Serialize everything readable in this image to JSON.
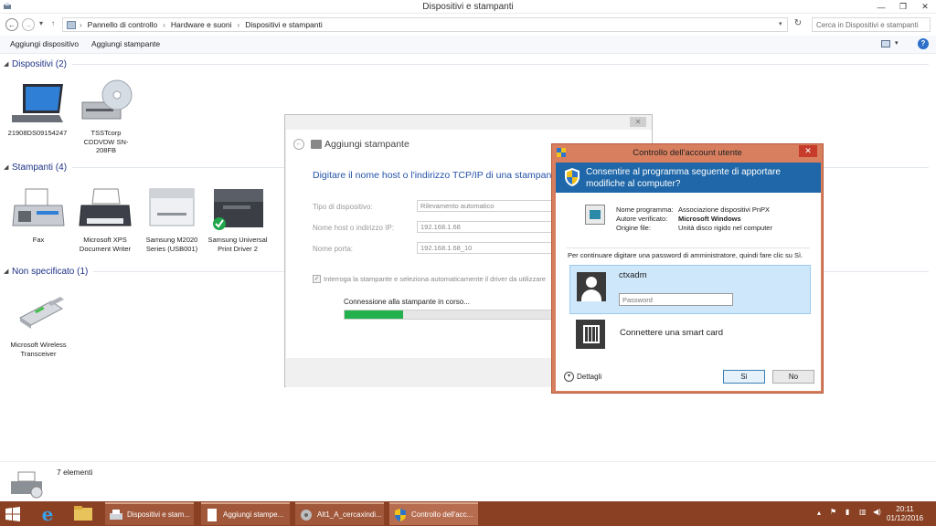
{
  "window": {
    "title": "Dispositivi e stampanti",
    "controls": [
      "—",
      "❐",
      "✕"
    ]
  },
  "address": {
    "crumbs": [
      "Pannello di controllo",
      "Hardware e suoni",
      "Dispositivi e stampanti"
    ],
    "search_placeholder": "Cerca in Dispositivi e stampanti"
  },
  "toolbar": {
    "add_device": "Aggiungi dispositivo",
    "add_printer": "Aggiungi stampante"
  },
  "groups": {
    "devices": "Dispositivi (2)",
    "printers": "Stampanti (4)",
    "unspecified": "Non specificato (1)"
  },
  "devices": [
    {
      "label": "21908DS09154247",
      "icon": "laptop-icon"
    },
    {
      "label": "TSSTcorp CDDVDW SN-208FB",
      "icon": "dvd-drive-icon"
    }
  ],
  "printers": [
    {
      "label": "Fax",
      "icon": "fax-icon"
    },
    {
      "label": "Microsoft XPS Document Writer",
      "icon": "printer-icon"
    },
    {
      "label": "Samsung M2020 Series (USB001)",
      "icon": "laser-printer-icon"
    },
    {
      "label": "Samsung Universal Print Driver 2",
      "icon": "multifunction-printer-icon",
      "default": true
    }
  ],
  "unspecified": [
    {
      "label": "Microsoft Wireless Transceiver",
      "icon": "usb-transceiver-icon"
    }
  ],
  "status": {
    "count": "7 elementi"
  },
  "wizard": {
    "title": "Aggiungi stampante",
    "heading": "Digitare il nome host o l'indirizzo TCP/IP di una stampante",
    "device_type_label": "Tipo di dispositivo:",
    "device_type_value": "Rilevamento automatico",
    "host_label": "Nome host o indirizzo IP:",
    "host_value": "192.168.1.68",
    "port_label": "Nome porta:",
    "port_value": "192.168.1.68_10",
    "query_checkbox": "Interroga la stampante e seleziona automaticamente il driver da utilizzare",
    "connecting": "Connessione alla stampante in corso...",
    "progress": 0.28
  },
  "uac": {
    "title": "Controllo dell'account utente",
    "heading": "Consentire al programma seguente di apportare modifiche al computer?",
    "program_name_label": "Nome programma:",
    "program_name": "Associazione dispositivi PnPX",
    "publisher_label": "Autore verificato:",
    "publisher": "Microsoft Windows",
    "origin_label": "Origine file:",
    "origin": "Unità disco rigido nel computer",
    "instructions": "Per continuare digitare una password di amministratore, quindi fare clic su Sì.",
    "username": "ctxadm",
    "password_placeholder": "Password",
    "smart_card": "Connettere una smart card",
    "details": "Dettagli",
    "yes": "Sì",
    "no": "No"
  },
  "taskbar": {
    "buttons": [
      {
        "label": "Dispositivi e stam..."
      },
      {
        "label": "Aggiungi stampe..."
      },
      {
        "label": "Alt1_A_cercaxindi..."
      },
      {
        "label": "Controllo dell'acc..."
      }
    ],
    "time": "20:11",
    "date": "01/12/2016"
  },
  "colors": {
    "taskbar": "#8a4022",
    "uac_frame": "#d87f60",
    "uac_banner": "#1f67a8",
    "progress": "#23b14d",
    "group_title": "#1e3287"
  }
}
